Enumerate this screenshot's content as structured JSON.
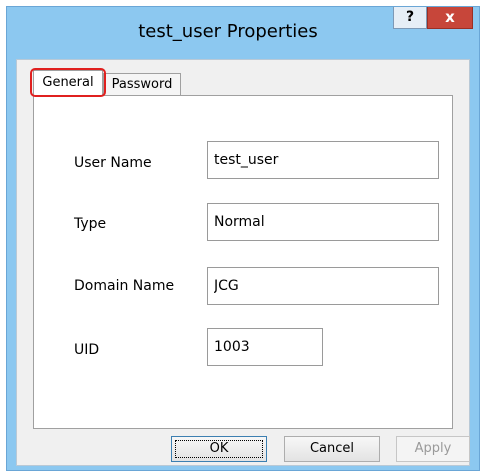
{
  "window": {
    "title": "test_user Properties",
    "help_label": "?",
    "close_label": "x"
  },
  "tabs": [
    {
      "label": "General",
      "selected": true
    },
    {
      "label": "Password",
      "selected": false
    }
  ],
  "fields": {
    "user_name": {
      "label": "User Name",
      "value": "test_user"
    },
    "type": {
      "label": "Type",
      "value": "Normal"
    },
    "domain_name": {
      "label": "Domain Name",
      "value": "JCG"
    },
    "uid": {
      "label": "UID",
      "value": "1003"
    }
  },
  "buttons": {
    "ok": "OK",
    "cancel": "Cancel",
    "apply": "Apply"
  },
  "colors": {
    "frame": "#8cc8f0",
    "close": "#c7463a",
    "highlight": "#e0201f"
  }
}
